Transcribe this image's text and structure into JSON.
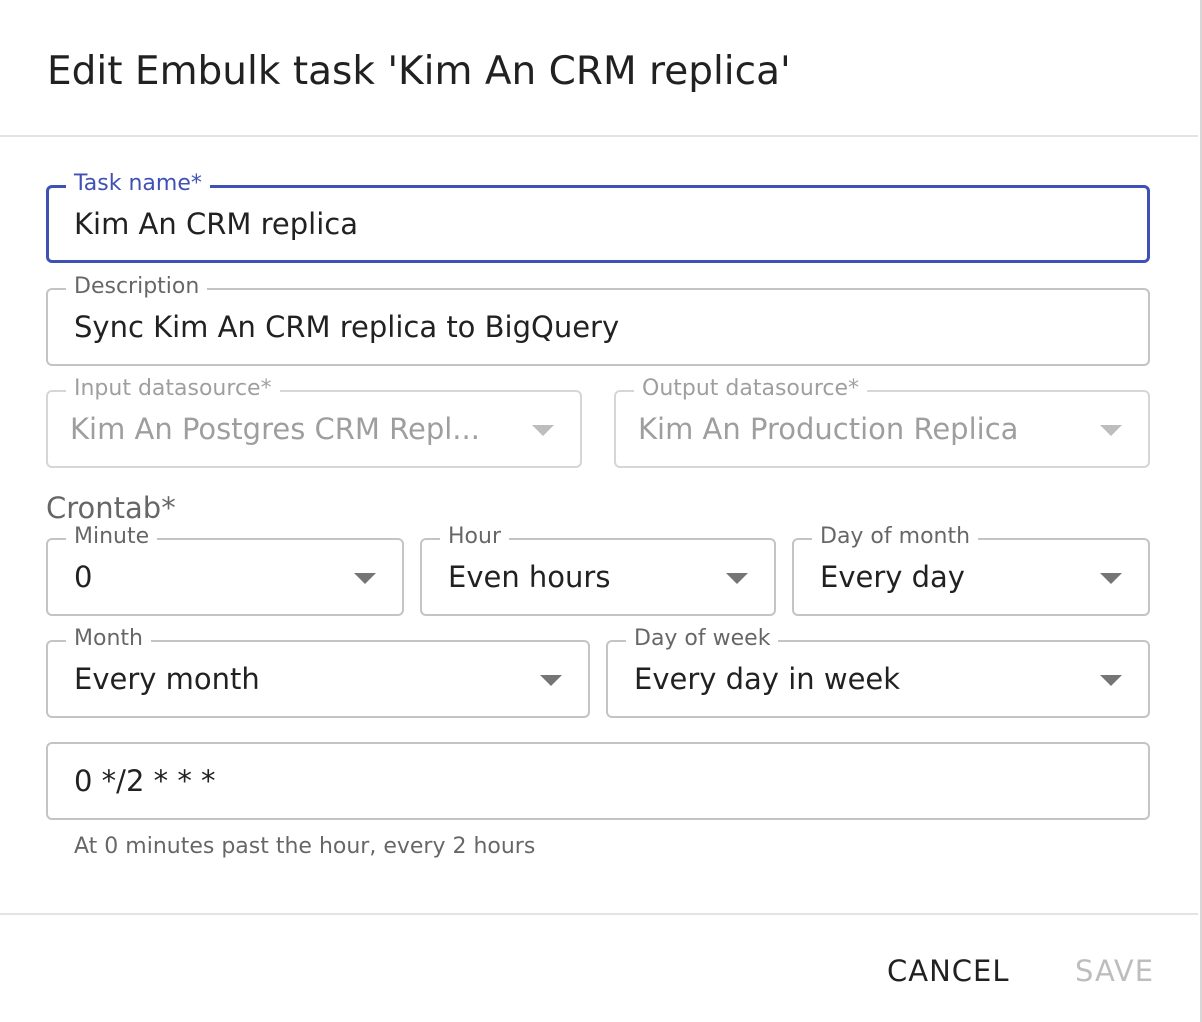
{
  "dialog": {
    "title": "Edit Embulk task 'Kim An CRM replica'"
  },
  "form": {
    "task_name": {
      "label": "Task name*",
      "value": "Kim An CRM replica"
    },
    "description": {
      "label": "Description",
      "value": "Sync Kim An CRM replica to BigQuery"
    },
    "input_datasource": {
      "label": "Input datasource*",
      "value": "Kim An Postgres CRM Repl..."
    },
    "output_datasource": {
      "label": "Output datasource*",
      "value": "Kim An Production Replica"
    },
    "crontab": {
      "label": "Crontab*",
      "minute": {
        "label": "Minute",
        "value": "0"
      },
      "hour": {
        "label": "Hour",
        "value": "Even hours"
      },
      "day_of_month": {
        "label": "Day of month",
        "value": "Every day"
      },
      "month": {
        "label": "Month",
        "value": "Every month"
      },
      "day_of_week": {
        "label": "Day of week",
        "value": "Every day in week"
      },
      "expression": "0 */2 * * *",
      "helper": "At 0 minutes past the hour, every 2 hours"
    }
  },
  "actions": {
    "cancel_label": "CANCEL",
    "save_label": "SAVE"
  },
  "colors": {
    "accent": "#3f51b5",
    "border": "#c4c4c4",
    "disabled_text": "rgba(0,0,0,0.38)"
  }
}
